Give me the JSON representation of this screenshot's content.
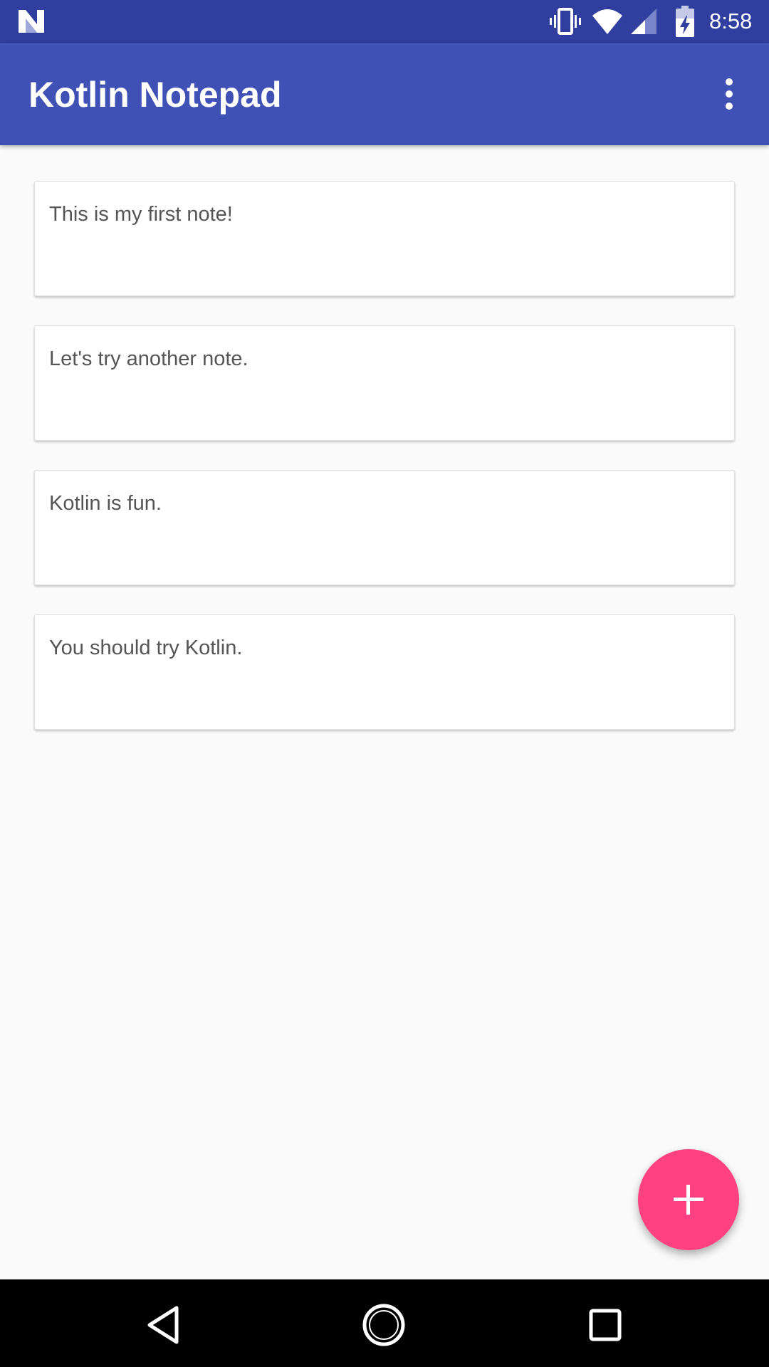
{
  "status_bar": {
    "time": "8:58",
    "icons": [
      "n-logo-icon",
      "vibrate-icon",
      "wifi-icon",
      "signal-icon",
      "battery-charging-icon"
    ]
  },
  "app_bar": {
    "title": "Kotlin Notepad",
    "overflow_icon": "more-vert-icon"
  },
  "notes": [
    {
      "text": "This is my first note!"
    },
    {
      "text": "Let's try another note."
    },
    {
      "text": "Kotlin is fun."
    },
    {
      "text": "You should try Kotlin."
    }
  ],
  "fab": {
    "icon": "add-icon"
  },
  "nav_bar": {
    "icons": [
      "back-icon",
      "home-icon",
      "recents-icon"
    ]
  },
  "colors": {
    "status_bar": "#303F9F",
    "primary": "#3F51B5",
    "accent": "#FF4081",
    "background": "#FAFAFA",
    "card": "#FFFFFF",
    "note_text": "#555555",
    "nav_bar": "#000000"
  }
}
